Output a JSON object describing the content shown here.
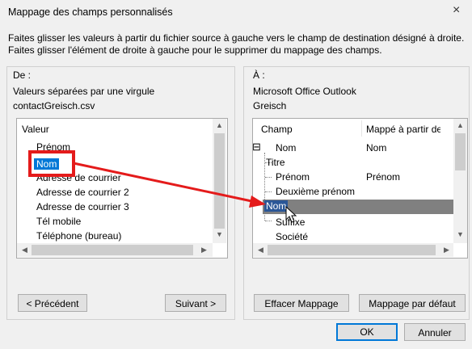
{
  "window": {
    "title": "Mappage des champs personnalisés",
    "close_label": "×"
  },
  "instruction": "Faites glisser les valeurs à partir du fichier source à gauche vers le champ de destination désigné à droite. Faites glisser l'élément de droite à gauche pour le supprimer du mappage des champs.",
  "from": {
    "label": "De :",
    "source_type": "Valeurs séparées par une virgule",
    "file": "contactGreisch.csv",
    "header": "Valeur",
    "items": [
      "Prénom",
      "Nom",
      "Adresse de courrier",
      "Adresse de courrier 2",
      "Adresse de courrier 3",
      "Tél mobile",
      "Téléphone (bureau)"
    ],
    "selected": "Nom"
  },
  "to": {
    "label": "À :",
    "app": "Microsoft Office Outlook",
    "folder": "Greisch",
    "header_field": "Champ",
    "header_mapped": "Mappé à partir de",
    "tree_root": "Nom",
    "tree_root_mapped": "Nom",
    "children": [
      {
        "name": "Titre",
        "mapped": ""
      },
      {
        "name": "Prénom",
        "mapped": "Prénom"
      },
      {
        "name": "Deuxième prénom",
        "mapped": ""
      },
      {
        "name": "Nom",
        "mapped": ""
      },
      {
        "name": "Suffixe",
        "mapped": ""
      }
    ],
    "after": "Société",
    "expander": "⊟"
  },
  "buttons": {
    "prev": "< Précédent",
    "next": "Suivant >",
    "clear": "Effacer Mappage",
    "default_map": "Mappage par défaut",
    "ok": "OK",
    "cancel": "Annuler"
  },
  "colors": {
    "accent": "#0078d7",
    "annotation": "#e41b1b"
  }
}
